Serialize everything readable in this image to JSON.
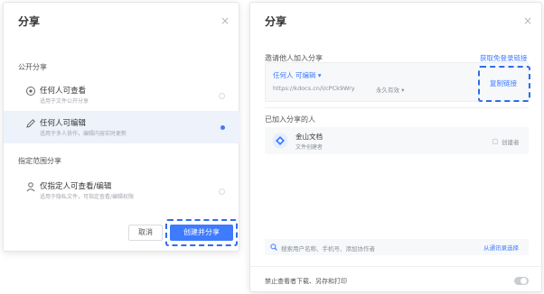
{
  "left_dialog": {
    "title": "分享",
    "close_icon": "close-icon",
    "public_section_label": "公开分享",
    "options": [
      {
        "title": "任何人可查看",
        "desc": "适用于文件公开分享",
        "icon": "eye-icon",
        "selected": false
      },
      {
        "title": "任何人可编辑",
        "desc": "适用于多人协作，编辑内容实时更新",
        "icon": "pencil-icon",
        "selected": true
      }
    ],
    "restricted_section_label": "指定范围分享",
    "restricted_option": {
      "title": "仅指定人可查看/编辑",
      "desc": "适用于隐私文件，可指定查看/编辑权限",
      "icon": "user-icon",
      "selected": false
    },
    "cancel_label": "取消",
    "create_label": "创建并分享"
  },
  "right_dialog": {
    "title": "分享",
    "close_icon": "close-icon",
    "invite_label": "邀请他人加入分享",
    "free_login_link": "获取免登录链接",
    "permission_label": "任何人 可编辑 ▾",
    "share_url": "https://kdocs.cn/l/cPCk9Wry",
    "validity": "永久有效 ▾",
    "copy_link_label": "复制链接",
    "joined_label": "已加入分享的人",
    "member": {
      "name": "金山文档",
      "role_desc": "文件创建者",
      "badge": "创建者"
    },
    "search_placeholder": "搜索用户名称、手机号、添加协作者",
    "contacts_link": "从通讯录选择",
    "restrict_label": "禁止查看者下载、另存和打印",
    "restrict_enabled": false
  },
  "colors": {
    "accent": "#3f7bff",
    "highlight": "#2f6de6",
    "selected_bg": "#edf2fb"
  }
}
